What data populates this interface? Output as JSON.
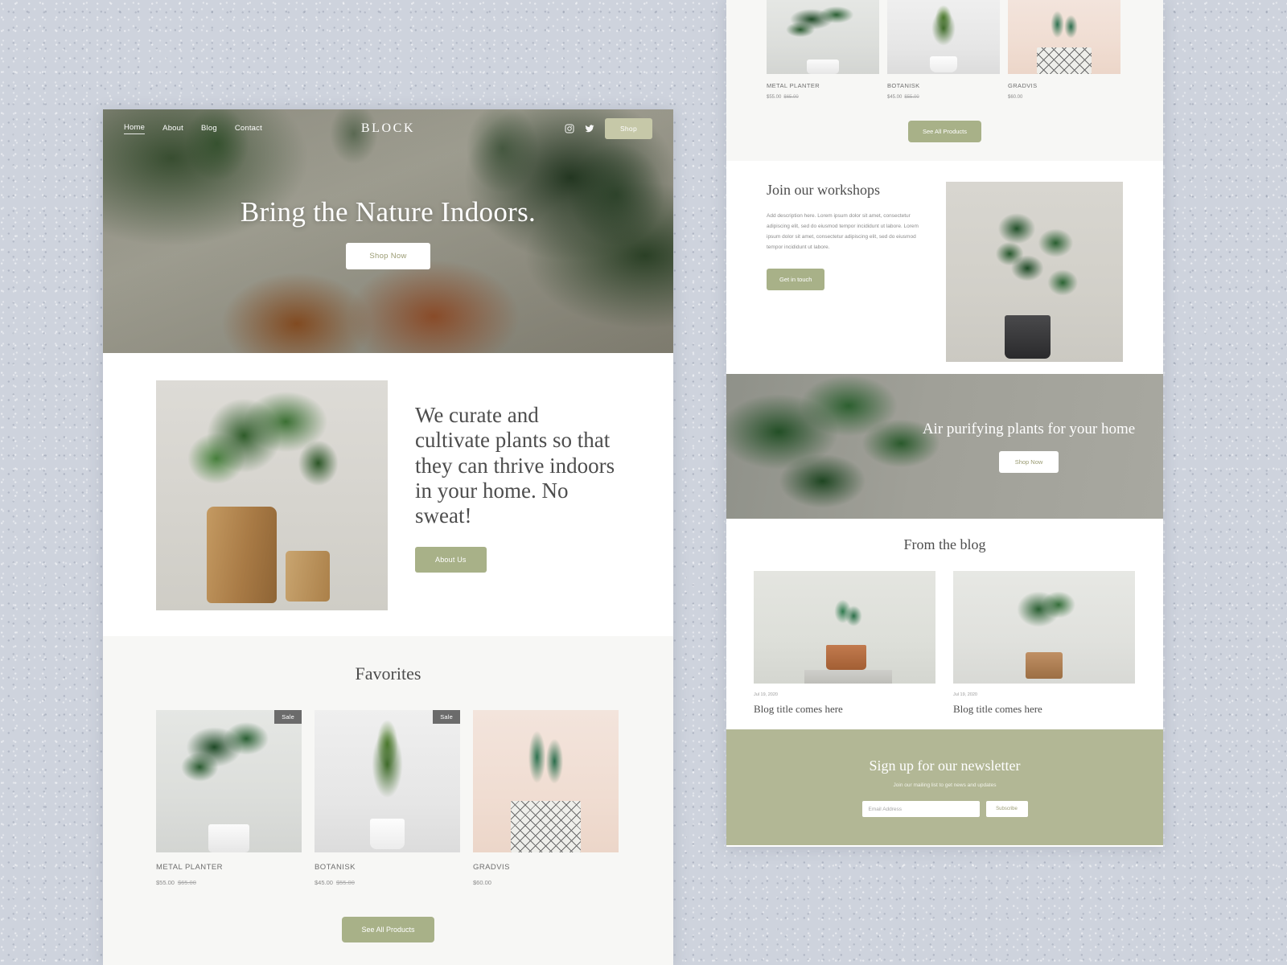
{
  "site": {
    "brand": "BLOCK",
    "nav": [
      {
        "label": "Home",
        "active": true
      },
      {
        "label": "About",
        "active": false
      },
      {
        "label": "Blog",
        "active": false
      },
      {
        "label": "Contact",
        "active": false
      }
    ],
    "social": [
      "instagram-icon",
      "twitter-icon"
    ],
    "shop_button": "Shop"
  },
  "hero": {
    "title": "Bring the Nature Indoors.",
    "cta": "Shop Now"
  },
  "curate": {
    "heading": "We curate and cultivate plants so that they can thrive indoors in your home. No sweat!",
    "cta": "About Us"
  },
  "favorites": {
    "heading": "Favorites",
    "see_all": "See All Products",
    "products": [
      {
        "name": "METAL PLANTER",
        "price": "$55.00",
        "old_price": "$65.00",
        "badge": "Sale"
      },
      {
        "name": "BOTANISK",
        "price": "$45.00",
        "old_price": "$55.00",
        "badge": "Sale"
      },
      {
        "name": "GRADVIS",
        "price": "$60.00",
        "old_price": "",
        "badge": ""
      }
    ]
  },
  "workshops": {
    "heading": "Join our workshops",
    "body": "Add description here. Lorem ipsum dolor sit amet, consectetur adipiscing elit, sed do eiusmod tempor incididunt ut labore. Lorem ipsum dolor sit amet, consectetur adipiscing elit, sed do eiusmod tempor incididunt ut labore.",
    "cta": "Get in touch"
  },
  "air_banner": {
    "heading": "Air purifying plants for your home",
    "cta": "Shop Now"
  },
  "blog": {
    "heading": "From the blog",
    "posts": [
      {
        "date": "Jul 19, 2020",
        "title": "Blog title comes here"
      },
      {
        "date": "Jul 19, 2020",
        "title": "Blog title comes here"
      }
    ]
  },
  "newsletter": {
    "heading": "Sign up for our newsletter",
    "subtitle": "Join our mailing list to get news and updates",
    "placeholder": "Email Address",
    "value": "",
    "button": "Subscribe"
  },
  "colors": {
    "olive": "#a8b188",
    "newsletter_bg": "#b2b795",
    "shop_btn": "#c6c8a8",
    "badge": "#6b6b6b",
    "backdrop": "#ced3dd"
  }
}
